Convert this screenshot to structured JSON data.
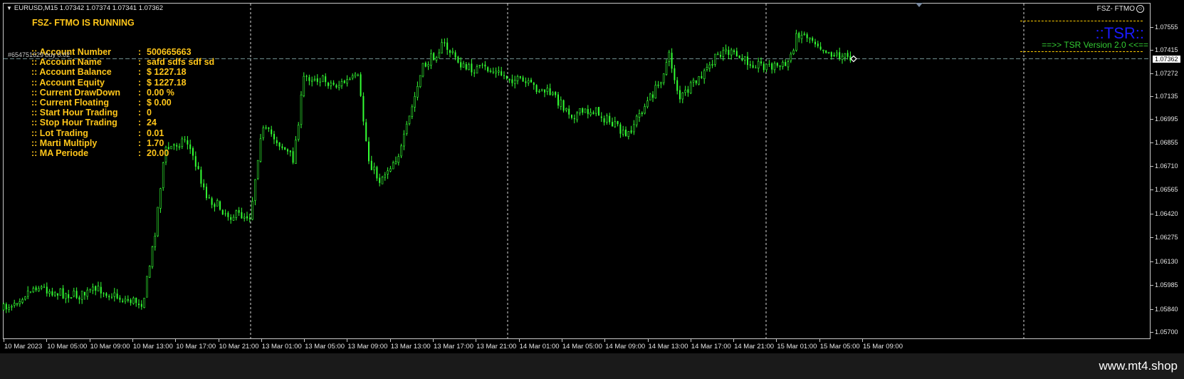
{
  "header": {
    "symbol_info": "EURUSD,M15  1.07342 1.07374 1.07341 1.07362",
    "ea_name": "FSZ- FTMO"
  },
  "panel": {
    "title": "FSZ- FTMO IS RUNNING",
    "rows": [
      {
        "label": ":: Account Number",
        "value": "500665663"
      },
      {
        "label": ":: Account Name",
        "value": "safd    sdfs sdf  sd"
      },
      {
        "label": ":: Account Balance",
        "value": "$ 1227.18"
      },
      {
        "label": ":: Account Equity",
        "value": "$ 1227.18"
      },
      {
        "label": ":: Current DrawDown",
        "value": "0.00 %"
      },
      {
        "label": ":: Current Floating",
        "value": "$ 0.00"
      },
      {
        "label": ":: Start Hour Trading",
        "value": "0"
      },
      {
        "label": ":: Stop Hour Trading",
        "value": "24"
      },
      {
        "label": ":: Lot Trading",
        "value": "0.01"
      },
      {
        "label": ":: Marti Multiply",
        "value": "1.70"
      },
      {
        "label": ":: MA Periode",
        "value": "20.00"
      }
    ],
    "separator": ":"
  },
  "order_label": "#654751629 buy 0.02",
  "tsr": {
    "logo": "::TSR::",
    "version": "==>>  TSR Version 2.0  <<=="
  },
  "price_axis": {
    "labels": [
      "1.07555",
      "1.07415",
      "1.07272",
      "1.07135",
      "1.06995",
      "1.06855",
      "1.06710",
      "1.06565",
      "1.06420",
      "1.06275",
      "1.06130",
      "1.05985",
      "1.05840",
      "1.05700"
    ],
    "current_price": "1.07362"
  },
  "time_axis": {
    "labels": [
      "10 Mar 2023",
      "10 Mar 05:00",
      "10 Mar 09:00",
      "10 Mar 13:00",
      "10 Mar 17:00",
      "10 Mar 21:00",
      "13 Mar 01:00",
      "13 Mar 05:00",
      "13 Mar 09:00",
      "13 Mar 13:00",
      "13 Mar 17:00",
      "13 Mar 21:00",
      "14 Mar 01:00",
      "14 Mar 05:00",
      "14 Mar 09:00",
      "14 Mar 13:00",
      "14 Mar 17:00",
      "14 Mar 21:00",
      "15 Mar 01:00",
      "15 Mar 05:00",
      "15 Mar 09:00"
    ]
  },
  "watermark": "www.mt4.shop",
  "colors": {
    "background": "#000000",
    "candles": "#33ff33",
    "panel_text": "#ffc61a",
    "tsr_logo": "#1a1aff",
    "tsr_version": "#33cc33",
    "bid_line": "#6f8f8f"
  },
  "chart_data": {
    "type": "candlestick",
    "symbol": "EURUSD",
    "timeframe": "M15",
    "ylim": [
      1.057,
      1.076
    ],
    "current_price": 1.07362,
    "close_path": [
      {
        "t": "10 Mar 2023",
        "price": 1.0584
      },
      {
        "t": "10 Mar 03:00",
        "price": 1.0598
      },
      {
        "t": "10 Mar 05:00",
        "price": 1.0594
      },
      {
        "t": "10 Mar 07:00",
        "price": 1.0592
      },
      {
        "t": "10 Mar 09:00",
        "price": 1.0596
      },
      {
        "t": "10 Mar 11:00",
        "price": 1.059
      },
      {
        "t": "10 Mar 13:00",
        "price": 1.0588
      },
      {
        "t": "10 Mar 14:00",
        "price": 1.0625
      },
      {
        "t": "10 Mar 15:00",
        "price": 1.068
      },
      {
        "t": "10 Mar 17:00",
        "price": 1.0688
      },
      {
        "t": "10 Mar 19:00",
        "price": 1.0652
      },
      {
        "t": "10 Mar 21:00",
        "price": 1.0641
      },
      {
        "t": "10 Mar 23:00",
        "price": 1.0641
      },
      {
        "t": "13 Mar 00:00",
        "price": 1.0693
      },
      {
        "t": "13 Mar 01:00",
        "price": 1.069
      },
      {
        "t": "13 Mar 03:00",
        "price": 1.0675
      },
      {
        "t": "13 Mar 04:00",
        "price": 1.0725
      },
      {
        "t": "13 Mar 05:00",
        "price": 1.0725
      },
      {
        "t": "13 Mar 07:00",
        "price": 1.072
      },
      {
        "t": "13 Mar 09:00",
        "price": 1.0725
      },
      {
        "t": "13 Mar 10:00",
        "price": 1.0675
      },
      {
        "t": "13 Mar 11:00",
        "price": 1.0662
      },
      {
        "t": "13 Mar 13:00",
        "price": 1.068
      },
      {
        "t": "13 Mar 14:00",
        "price": 1.0705
      },
      {
        "t": "13 Mar 15:00",
        "price": 1.073
      },
      {
        "t": "13 Mar 17:00",
        "price": 1.0745
      },
      {
        "t": "13 Mar 19:00",
        "price": 1.073
      },
      {
        "t": "13 Mar 21:00",
        "price": 1.073
      },
      {
        "t": "14 Mar 01:00",
        "price": 1.072
      },
      {
        "t": "14 Mar 03:00",
        "price": 1.0715
      },
      {
        "t": "14 Mar 05:00",
        "price": 1.0702
      },
      {
        "t": "14 Mar 07:00",
        "price": 1.0705
      },
      {
        "t": "14 Mar 09:00",
        "price": 1.0695
      },
      {
        "t": "14 Mar 10:00",
        "price": 1.0688
      },
      {
        "t": "14 Mar 11:00",
        "price": 1.07
      },
      {
        "t": "14 Mar 13:00",
        "price": 1.072
      },
      {
        "t": "14 Mar 14:00",
        "price": 1.0738
      },
      {
        "t": "14 Mar 15:00",
        "price": 1.0712
      },
      {
        "t": "14 Mar 17:00",
        "price": 1.0725
      },
      {
        "t": "14 Mar 19:00",
        "price": 1.0742
      },
      {
        "t": "14 Mar 21:00",
        "price": 1.0735
      },
      {
        "t": "14 Mar 23:00",
        "price": 1.0732
      },
      {
        "t": "15 Mar 01:00",
        "price": 1.0732
      },
      {
        "t": "15 Mar 02:00",
        "price": 1.0752
      },
      {
        "t": "15 Mar 03:00",
        "price": 1.075
      },
      {
        "t": "15 Mar 05:00",
        "price": 1.074
      },
      {
        "t": "15 Mar 07:00",
        "price": 1.0736
      }
    ]
  }
}
